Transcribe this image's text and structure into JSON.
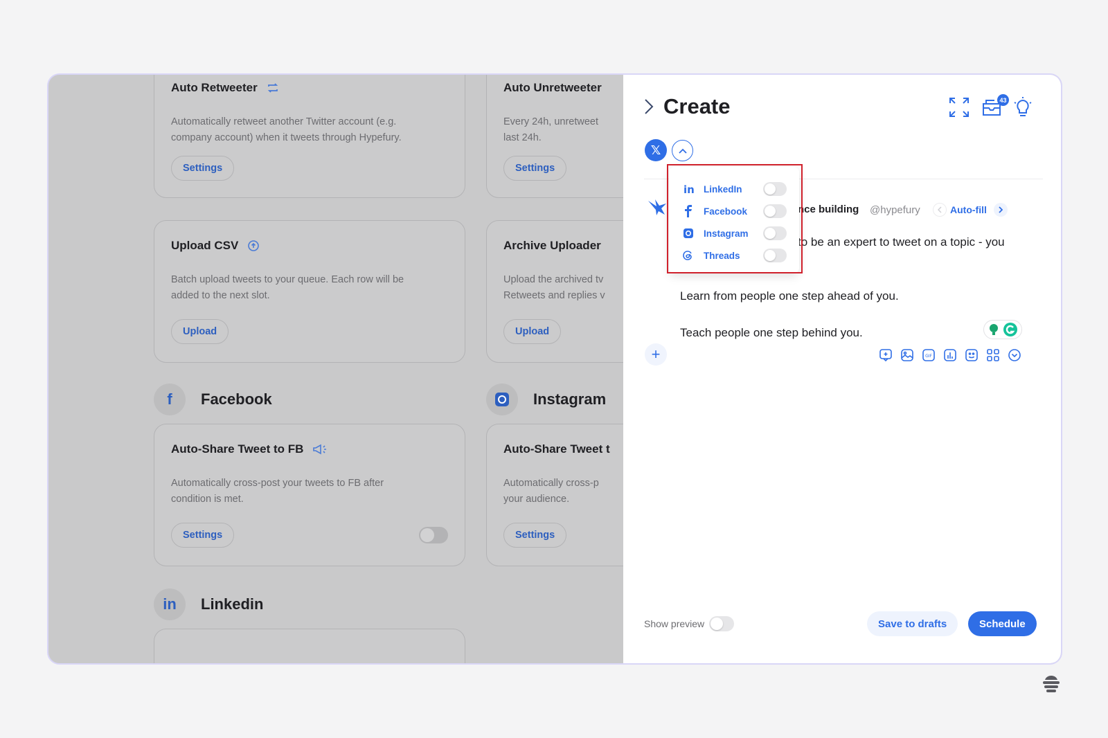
{
  "background": {
    "cards": [
      {
        "title": "Auto Retweeter",
        "desc1": "Automatically retweet another Twitter account (e.g.",
        "desc2": "company account) when it tweets through Hypefury.",
        "button": "Settings"
      },
      {
        "title": "Auto Unretweeter",
        "desc1": "Every 24h, unretweet",
        "desc2": "last 24h.",
        "button": "Settings"
      },
      {
        "title": "Upload CSV",
        "desc1": "Batch upload tweets to your queue. Each row will be",
        "desc2": "added to the next slot.",
        "button": "Upload"
      },
      {
        "title": "Archive Uploader",
        "desc1": "Upload the archived tv",
        "desc2": "Retweets and replies v",
        "button": "Upload"
      },
      {
        "title": "Auto-Share Tweet to FB",
        "desc1": "Automatically cross-post your tweets to FB after",
        "desc2": "condition is met.",
        "button": "Settings"
      },
      {
        "title": "Auto-Share Tweet t",
        "desc1": "Automatically cross-p",
        "desc2": "your audience.",
        "button": "Settings"
      }
    ],
    "sections": {
      "facebook": "Facebook",
      "instagram": "Instagram",
      "linkedin": "Linkedin"
    }
  },
  "panel": {
    "title": "Create",
    "inbox_badge": "43",
    "account_name": "nce building",
    "account_handle": "@hypefury",
    "autofill_label": "Auto-fill",
    "tweet_lines": [
      "to be an expert to tweet on a topic - you",
      "Learn from people one step ahead of you.",
      "Teach people one step behind you."
    ],
    "show_preview_label": "Show preview",
    "save_drafts_label": "Save to drafts",
    "schedule_label": "Schedule"
  },
  "dropdown": {
    "items": [
      {
        "label": "LinkedIn",
        "icon": "linkedin-icon"
      },
      {
        "label": "Facebook",
        "icon": "facebook-icon"
      },
      {
        "label": "Instagram",
        "icon": "instagram-icon"
      },
      {
        "label": "Threads",
        "icon": "threads-icon"
      }
    ]
  },
  "colors": {
    "accent": "#2f6ee6",
    "highlight": "#d0212c"
  }
}
